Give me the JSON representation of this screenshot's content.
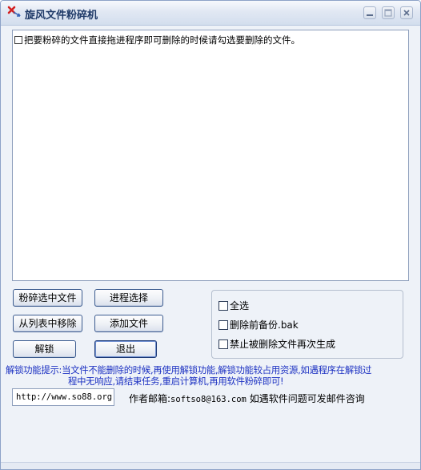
{
  "window": {
    "title": "旋风文件粉碎机",
    "icon": "red-x-arrow-icon"
  },
  "title_buttons": {
    "minimize": "minimize-icon",
    "maximize": "maximize-icon",
    "close": "close-icon"
  },
  "file_list": {
    "items": [
      {
        "checked": false,
        "text": "把要粉碎的文件直接拖进程序即可删除的时候请勾选要删除的文件。"
      }
    ]
  },
  "buttons": {
    "shred_selected": "粉碎选中文件",
    "process_select": "进程选择",
    "remove_from_list": "从列表中移除",
    "add_file": "添加文件",
    "unlock": "解锁",
    "exit": "退出"
  },
  "options": {
    "select_all": {
      "label": "全选",
      "checked": false
    },
    "backup_before_delete": {
      "label": "删除前备份.bak",
      "checked": false
    },
    "prevent_regenerate": {
      "label": "禁止被删除文件再次生成",
      "checked": false
    }
  },
  "hint": {
    "line1": "解锁功能提示:当文件不能删除的时候,再使用解锁功能,解锁功能较占用资源,如遇程序在解锁过",
    "line2": "程中无响应,请结束任务,重启计算机,再用软件粉碎即可!"
  },
  "footer": {
    "url": "http://www.so88.org",
    "email_label": "作者邮箱:",
    "email": "softso8@163.com",
    "email_note": "如遇软件问题可发邮件咨询"
  },
  "colors": {
    "hint_text": "#1c31c2",
    "title_text": "#1f3a68",
    "window_bg": "#eef2f8"
  }
}
